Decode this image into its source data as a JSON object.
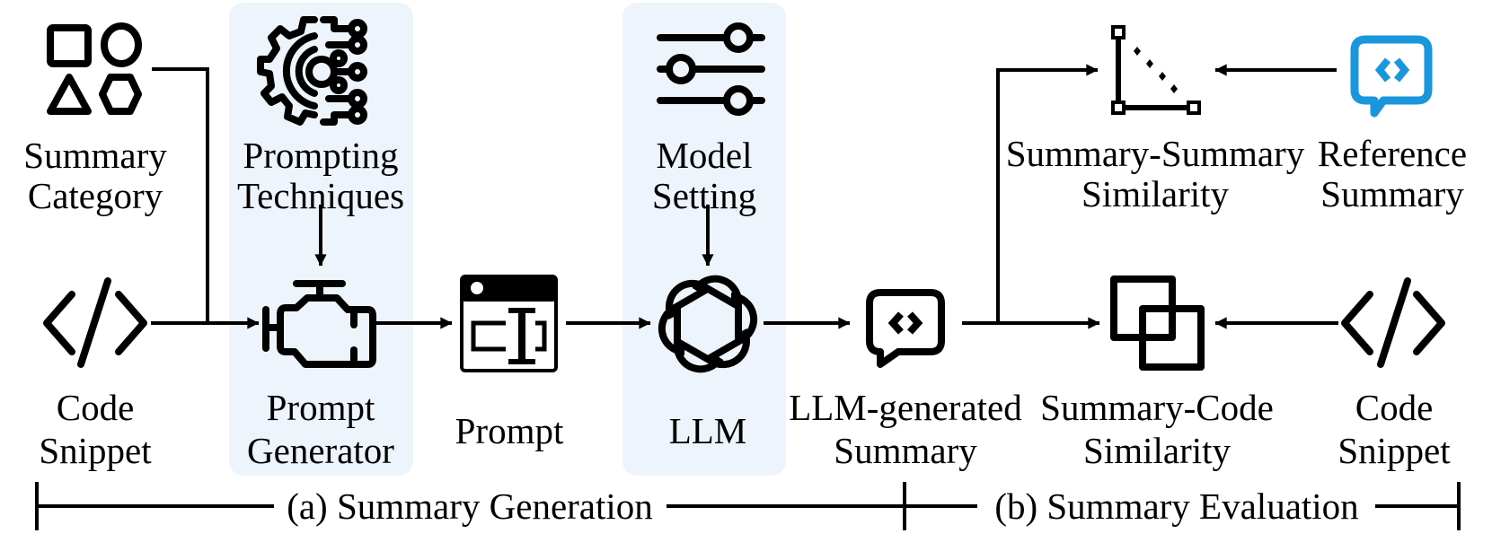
{
  "colors": {
    "panel": "#edf4fb",
    "ink": "#000000",
    "reference_icon": "#1a96dc"
  },
  "nodes": {
    "summary_category": {
      "icon": "shapes-icon",
      "line1": "Summary",
      "line2": "Category"
    },
    "code_snippet_input": {
      "icon": "code-icon",
      "line1": "Code",
      "line2": "Snippet"
    },
    "prompting_techniques": {
      "icon": "gear-circuit-icon",
      "line1": "Prompting",
      "line2": "Techniques"
    },
    "prompt_generator": {
      "icon": "engine-icon",
      "line1": "Prompt",
      "line2": "Generator"
    },
    "prompt": {
      "icon": "prompt-window-icon",
      "label": "Prompt"
    },
    "model_setting": {
      "icon": "sliders-icon",
      "line1": "Model",
      "line2": "Setting"
    },
    "llm": {
      "icon": "openai-logo-icon",
      "label": "LLM"
    },
    "llm_summary": {
      "icon": "chat-code-icon",
      "line1": "LLM-generated",
      "line2": "Summary"
    },
    "summary_summary_similarity": {
      "icon": "triangle-distance-icon",
      "line1": "Summary-Summary",
      "line2": "Similarity"
    },
    "reference_summary": {
      "icon": "chat-code-icon",
      "line1": "Reference",
      "line2": "Summary"
    },
    "summary_code_similarity": {
      "icon": "overlap-squares-icon",
      "line1": "Summary-Code",
      "line2": "Similarity"
    },
    "code_snippet_eval": {
      "icon": "code-icon",
      "line1": "Code",
      "line2": "Snippet"
    }
  },
  "phases": {
    "generation": "(a) Summary Generation",
    "evaluation": "(b) Summary Evaluation"
  }
}
